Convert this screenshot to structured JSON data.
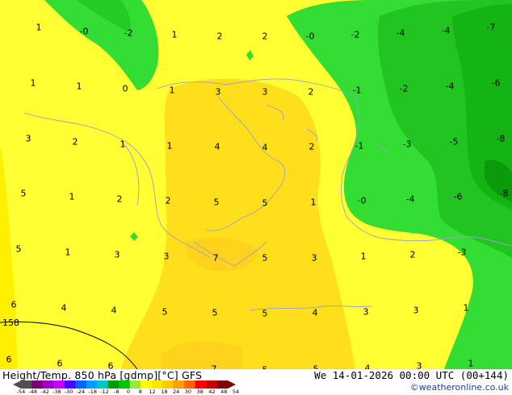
{
  "map": {
    "grid_values": [
      {
        "text": "1"
      },
      {
        "text": "-0"
      },
      {
        "text": "-2"
      },
      {
        "text": "1"
      },
      {
        "text": "2"
      },
      {
        "text": "2"
      },
      {
        "text": "-0"
      },
      {
        "text": "-2"
      },
      {
        "text": "-4"
      },
      {
        "text": "-4"
      },
      {
        "text": "-7"
      },
      {
        "text": "1"
      },
      {
        "text": "1"
      },
      {
        "text": "0"
      },
      {
        "text": "1"
      },
      {
        "text": "3"
      },
      {
        "text": "3"
      },
      {
        "text": "2"
      },
      {
        "text": "-1"
      },
      {
        "text": "-2"
      },
      {
        "text": "-4"
      },
      {
        "text": "-6"
      },
      {
        "text": "3"
      },
      {
        "text": "2"
      },
      {
        "text": "1"
      },
      {
        "text": "1"
      },
      {
        "text": "4"
      },
      {
        "text": "4"
      },
      {
        "text": "2"
      },
      {
        "text": "-1"
      },
      {
        "text": "-3"
      },
      {
        "text": "-5"
      },
      {
        "text": "-8"
      },
      {
        "text": "5"
      },
      {
        "text": "1"
      },
      {
        "text": "2"
      },
      {
        "text": "2"
      },
      {
        "text": "5"
      },
      {
        "text": "5"
      },
      {
        "text": "1"
      },
      {
        "text": "-0"
      },
      {
        "text": "-4"
      },
      {
        "text": "-6"
      },
      {
        "text": "-8"
      },
      {
        "text": "5"
      },
      {
        "text": "1"
      },
      {
        "text": "3"
      },
      {
        "text": "3"
      },
      {
        "text": "7"
      },
      {
        "text": "5"
      },
      {
        "text": "3"
      },
      {
        "text": "1"
      },
      {
        "text": "2"
      },
      {
        "text": "-3"
      },
      {
        "text": "6"
      },
      {
        "text": "4"
      },
      {
        "text": "4"
      },
      {
        "text": "5"
      },
      {
        "text": "5"
      },
      {
        "text": "5"
      },
      {
        "text": "4"
      },
      {
        "text": "3"
      },
      {
        "text": "3"
      },
      {
        "text": "1"
      },
      {
        "text": "6"
      },
      {
        "text": "6"
      },
      {
        "text": "6"
      },
      {
        "text": "7"
      },
      {
        "text": "5"
      },
      {
        "text": "5"
      },
      {
        "text": "4"
      },
      {
        "text": "3"
      },
      {
        "text": "1"
      }
    ],
    "contour_label": "158"
  },
  "footer": {
    "title": "Height/Temp. 850 hPa [gdmp][°C] GFS",
    "valid": "We 14-01-2026 00:00 UTC (00+144)",
    "credit": "©weatheronline.co.uk",
    "scale_ticks": [
      "-54",
      "-48",
      "-42",
      "-38",
      "-30",
      "-24",
      "-18",
      "-12",
      "-8",
      "0",
      "8",
      "12",
      "18",
      "24",
      "30",
      "38",
      "42",
      "48",
      "54"
    ],
    "scale_colors": [
      "#505050",
      "#7a007a",
      "#a000c8",
      "#c800ff",
      "#4b00ff",
      "#0064ff",
      "#00a0ff",
      "#00c8c8",
      "#00a000",
      "#00c800",
      "#a0e632",
      "#ffff00",
      "#ffe600",
      "#ffc800",
      "#ffa000",
      "#ff6400",
      "#ff0000",
      "#c80000",
      "#820000"
    ]
  }
}
